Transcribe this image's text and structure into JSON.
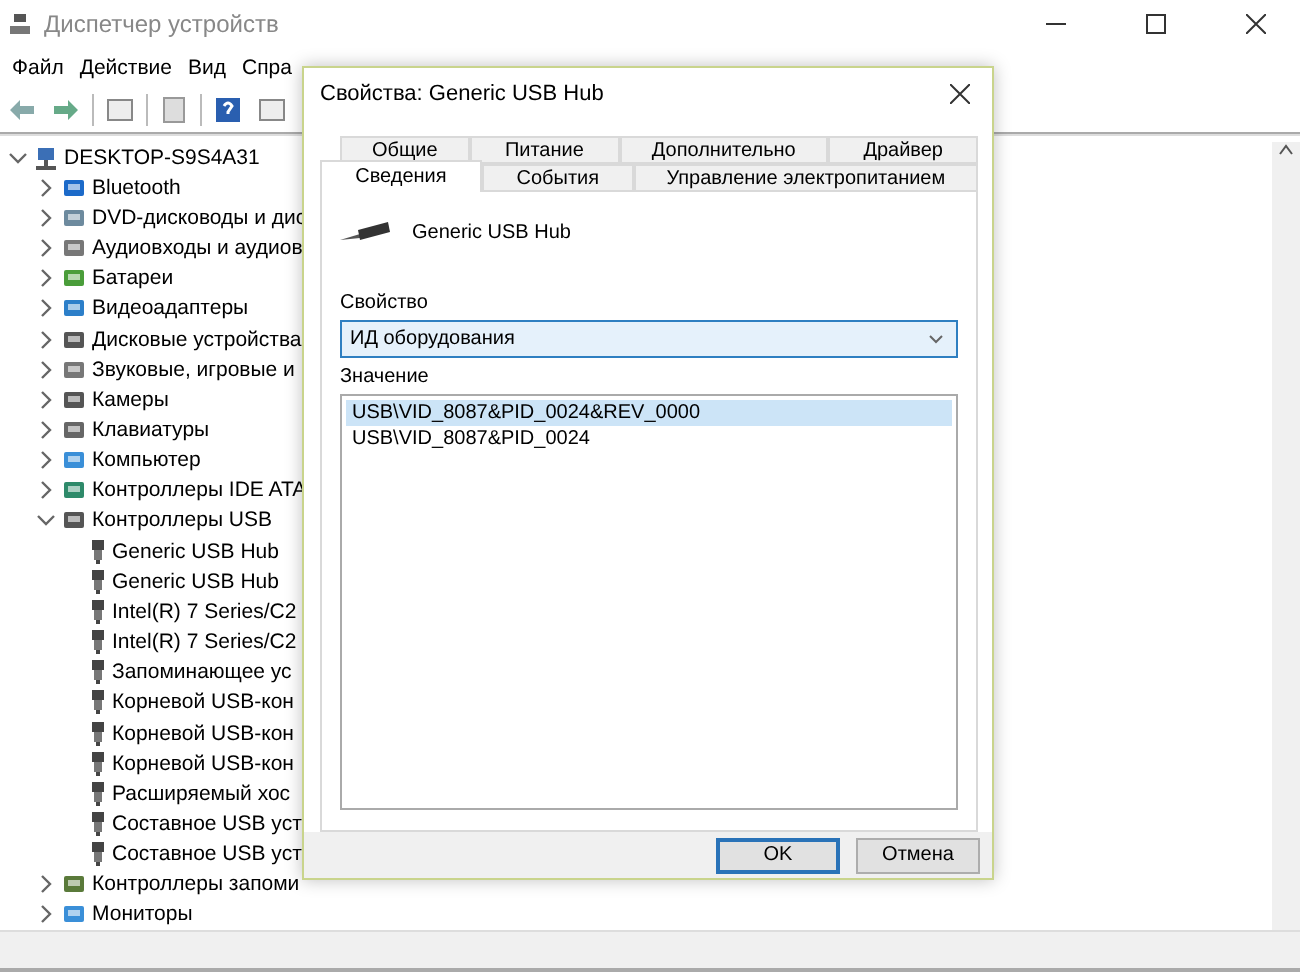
{
  "window": {
    "title": "Диспетчер устройств"
  },
  "menu": [
    {
      "label": "Файл"
    },
    {
      "label": "Действие"
    },
    {
      "label": "Вид"
    },
    {
      "label": "Спра"
    }
  ],
  "tree": [
    {
      "label": "DESKTOP-S9S4A31",
      "expanded": true,
      "children": [
        {
          "label": "Bluetooth",
          "expanded": false
        },
        {
          "label": "DVD-дисководы и дис",
          "expanded": false
        },
        {
          "label": "Аудиовходы и аудиов",
          "expanded": false
        },
        {
          "label": "Батареи",
          "expanded": false
        },
        {
          "label": "Видеоадаптеры",
          "expanded": false
        },
        {
          "label": "Дисковые устройства",
          "expanded": false
        },
        {
          "label": "Звуковые, игровые и",
          "expanded": false
        },
        {
          "label": "Камеры",
          "expanded": false
        },
        {
          "label": "Клавиатуры",
          "expanded": false
        },
        {
          "label": "Компьютер",
          "expanded": false
        },
        {
          "label": "Контроллеры IDE ATA",
          "expanded": false
        },
        {
          "label": "Контроллеры USB",
          "expanded": true,
          "children": [
            {
              "label": "Generic USB Hub"
            },
            {
              "label": "Generic USB Hub"
            },
            {
              "label": "Intel(R) 7 Series/C2"
            },
            {
              "label": "Intel(R) 7 Series/C2"
            },
            {
              "label": "Запоминающее ус"
            },
            {
              "label": "Корневой USB-кон"
            },
            {
              "label": "Корневой USB-кон"
            },
            {
              "label": "Корневой USB-кон"
            },
            {
              "label": "Расширяемый хос"
            },
            {
              "label": "Составное USB уст"
            },
            {
              "label": "Составное USB уст"
            }
          ]
        },
        {
          "label": "Контроллеры запоми",
          "expanded": false
        },
        {
          "label": "Мониторы",
          "expanded": false
        }
      ]
    }
  ],
  "dialog": {
    "title": "Свойства: Generic USB Hub",
    "tab_rows": [
      [
        {
          "label": "Общие",
          "selected": false
        },
        {
          "label": "Питание",
          "selected": false
        },
        {
          "label": "Дополнительно",
          "selected": false
        },
        {
          "label": "Драйвер",
          "selected": false
        }
      ],
      [
        {
          "label": "Сведения",
          "selected": true
        },
        {
          "label": "События",
          "selected": false
        },
        {
          "label": "Управление электропитанием",
          "selected": false
        }
      ]
    ],
    "device_name": "Generic USB Hub",
    "property": {
      "label": "Свойство",
      "value": "ИД оборудования"
    },
    "value_list": {
      "label": "Значение",
      "items": [
        {
          "text": "USB\\VID_8087&PID_0024&REV_0000",
          "selected": true
        },
        {
          "text": "USB\\VID_8087&PID_0024",
          "selected": false
        }
      ]
    },
    "buttons": [
      {
        "label": "OK",
        "default": true
      },
      {
        "label": "Отмена",
        "default": false
      }
    ]
  }
}
